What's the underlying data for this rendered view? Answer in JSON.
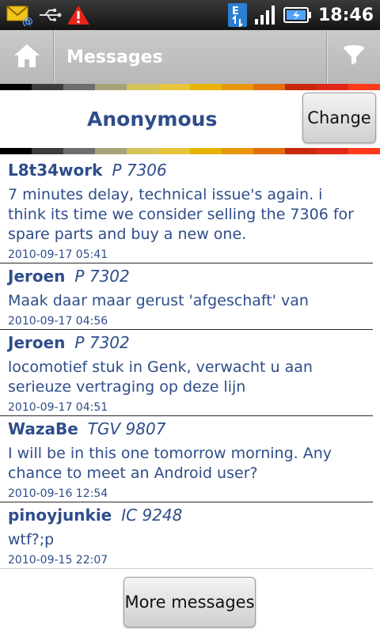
{
  "status_bar": {
    "time": "18:46",
    "icons": [
      "email-notification-icon",
      "usb-icon",
      "warning-icon",
      "network-e-icon",
      "signal-icon",
      "battery-charging-icon"
    ]
  },
  "action_bar": {
    "title": "Messages",
    "home_icon": "home-icon",
    "filter_icon": "filter-icon"
  },
  "strip_colors": [
    "#000000",
    "#3c3c3c",
    "#6e6e6e",
    "#a8a27a",
    "#d4c35a",
    "#e8c43c",
    "#e6b400",
    "#e8960a",
    "#e26e0c",
    "#c8280e",
    "#e02818",
    "#ff3a1a"
  ],
  "header": {
    "name": "Anonymous",
    "change_label": "Change"
  },
  "messages": [
    {
      "user": "L8t34work",
      "train": "P  7306",
      "text": "7 minutes delay, technical issue's again. i  think its time we consider selling the 7306 for spare parts and buy a new one.",
      "time": "2010-09-17 05:41"
    },
    {
      "user": "Jeroen",
      "train": "P  7302",
      "text": "Maak daar maar gerust 'afgeschaft' van",
      "time": "2010-09-17 04:56"
    },
    {
      "user": "Jeroen",
      "train": "P  7302",
      "text": "locomotief stuk in Genk, verwacht u aan serieuze vertraging op deze lijn",
      "time": "2010-09-17 04:51"
    },
    {
      "user": "WazaBe",
      "train": "TGV 9807",
      "text": "I will be in this one tomorrow morning. Any chance to meet an Android user?",
      "time": "2010-09-16 12:54"
    },
    {
      "user": "pinoyjunkie",
      "train": "IC  9248",
      "text": "wtf?;p",
      "time": "2010-09-15 22:07"
    }
  ],
  "more_label": "More messages",
  "colors": {
    "accent_text": "#2e4d8a",
    "action_bar": "#bcbcbc"
  }
}
